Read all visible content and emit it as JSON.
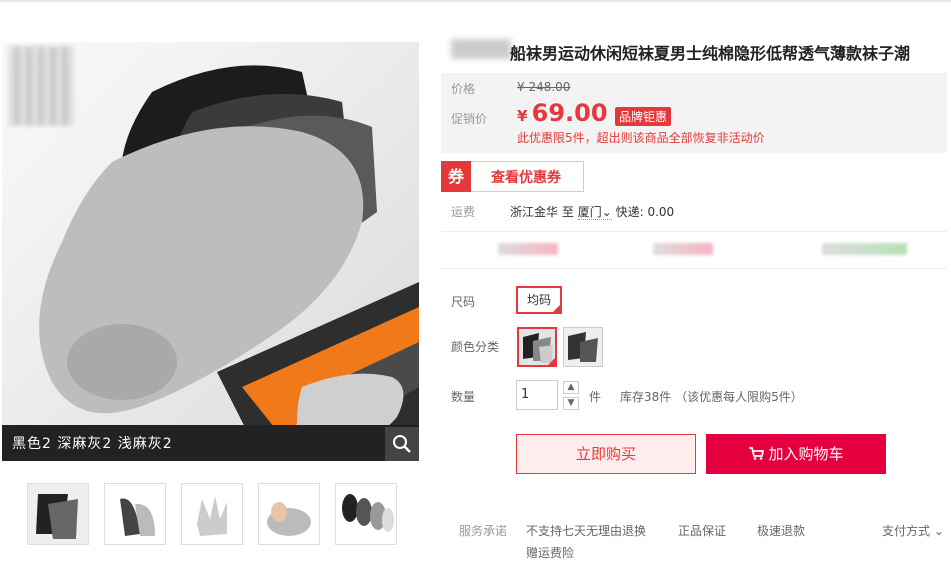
{
  "product": {
    "title": "船袜男运动休闲短袜夏男士纯棉隐形低帮透气薄款袜子潮"
  },
  "gallery": {
    "main_caption": "黑色2 深麻灰2 浅麻灰2",
    "zoom_icon": "magnifier-icon",
    "thumbnails": [
      "thumb-1",
      "thumb-2",
      "thumb-3",
      "thumb-4",
      "thumb-5"
    ]
  },
  "price": {
    "original_label": "价格",
    "original_value": "¥ 248.00",
    "promo_label": "促销价",
    "currency": "¥",
    "promo_value": "69.00",
    "badge": "品牌钜惠",
    "limit_note": "此优惠限5件，超出则该商品全部恢复非活动价"
  },
  "coupon": {
    "icon_char": "券",
    "text": "查看优惠券"
  },
  "shipping": {
    "label": "运费",
    "from": "浙江金华",
    "to_word": "至",
    "to": "厦门",
    "method": "快递: 0.00"
  },
  "options": {
    "size_label": "尺码",
    "size_value": "均码",
    "color_label": "颜色分类",
    "quantity_label": "数量",
    "quantity_value": "1",
    "quantity_unit": "件",
    "stock": "库存38件 （该优惠每人限购5件）"
  },
  "actions": {
    "buy_now": "立即购买",
    "add_to_cart": "加入购物车"
  },
  "service": {
    "label": "服务承诺",
    "items": [
      "不支持七天无理由退换",
      "正品保证",
      "极速退款",
      "赠运费险"
    ],
    "payment": "支付方式"
  },
  "colors": {
    "accent": "#e4393c",
    "cart_button": "#e4003f"
  }
}
